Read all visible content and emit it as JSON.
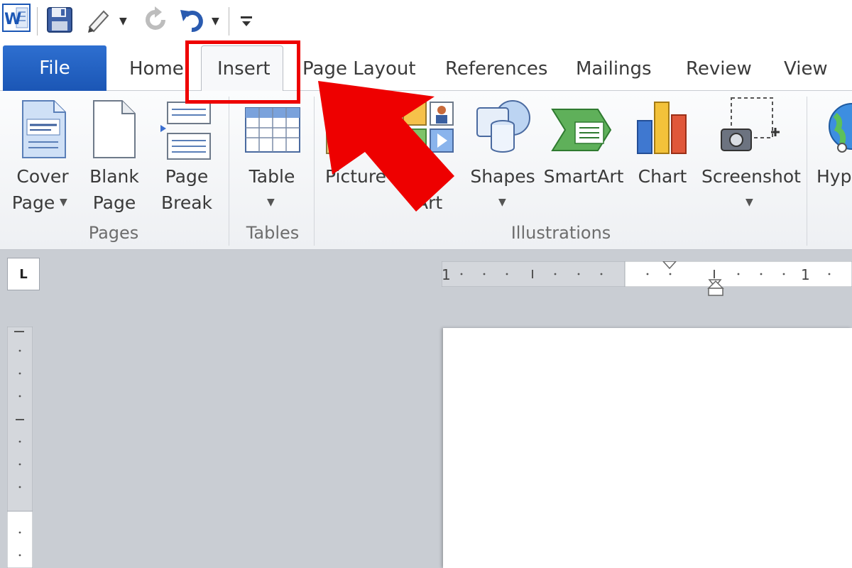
{
  "app": {
    "logo_letter": "W",
    "accent_color": "#1b56b5",
    "annotation_color": "#ee0000"
  },
  "quick_access": {
    "icons": [
      "word-logo-icon",
      "save-icon",
      "quick-edit-icon",
      "repeat-icon",
      "undo-icon",
      "customize-toolbar-icon"
    ]
  },
  "tabs": [
    {
      "label": "File"
    },
    {
      "label": "Home"
    },
    {
      "label": "Insert",
      "selected": true
    },
    {
      "label": "Page Layout"
    },
    {
      "label": "References"
    },
    {
      "label": "Mailings"
    },
    {
      "label": "Review"
    },
    {
      "label": "View"
    }
  ],
  "ribbon": {
    "pages_group": {
      "label": "Pages",
      "cover_page": {
        "line1": "Cover",
        "line2": "Page"
      },
      "blank_page": {
        "line1": "Blank",
        "line2": "Page"
      },
      "page_break": {
        "line1": "Page",
        "line2": "Break"
      }
    },
    "tables_group": {
      "label": "Tables",
      "table": {
        "line1": "Table"
      }
    },
    "illustrations_group": {
      "label": "Illustrations",
      "picture": {
        "line1": "Picture"
      },
      "clip_art": {
        "line1": "p",
        "line2": "Art"
      },
      "shapes": {
        "line1": "Shapes"
      },
      "smartart": {
        "line1": "SmartArt"
      },
      "chart": {
        "line1": "Chart"
      },
      "screenshot": {
        "line1": "Screenshot"
      }
    },
    "links_group": {
      "hyperlink": {
        "line1": "Hyp"
      }
    }
  },
  "rulers": {
    "h_numbers": [
      "1",
      "1"
    ],
    "tab_selector_glyph": "L"
  }
}
